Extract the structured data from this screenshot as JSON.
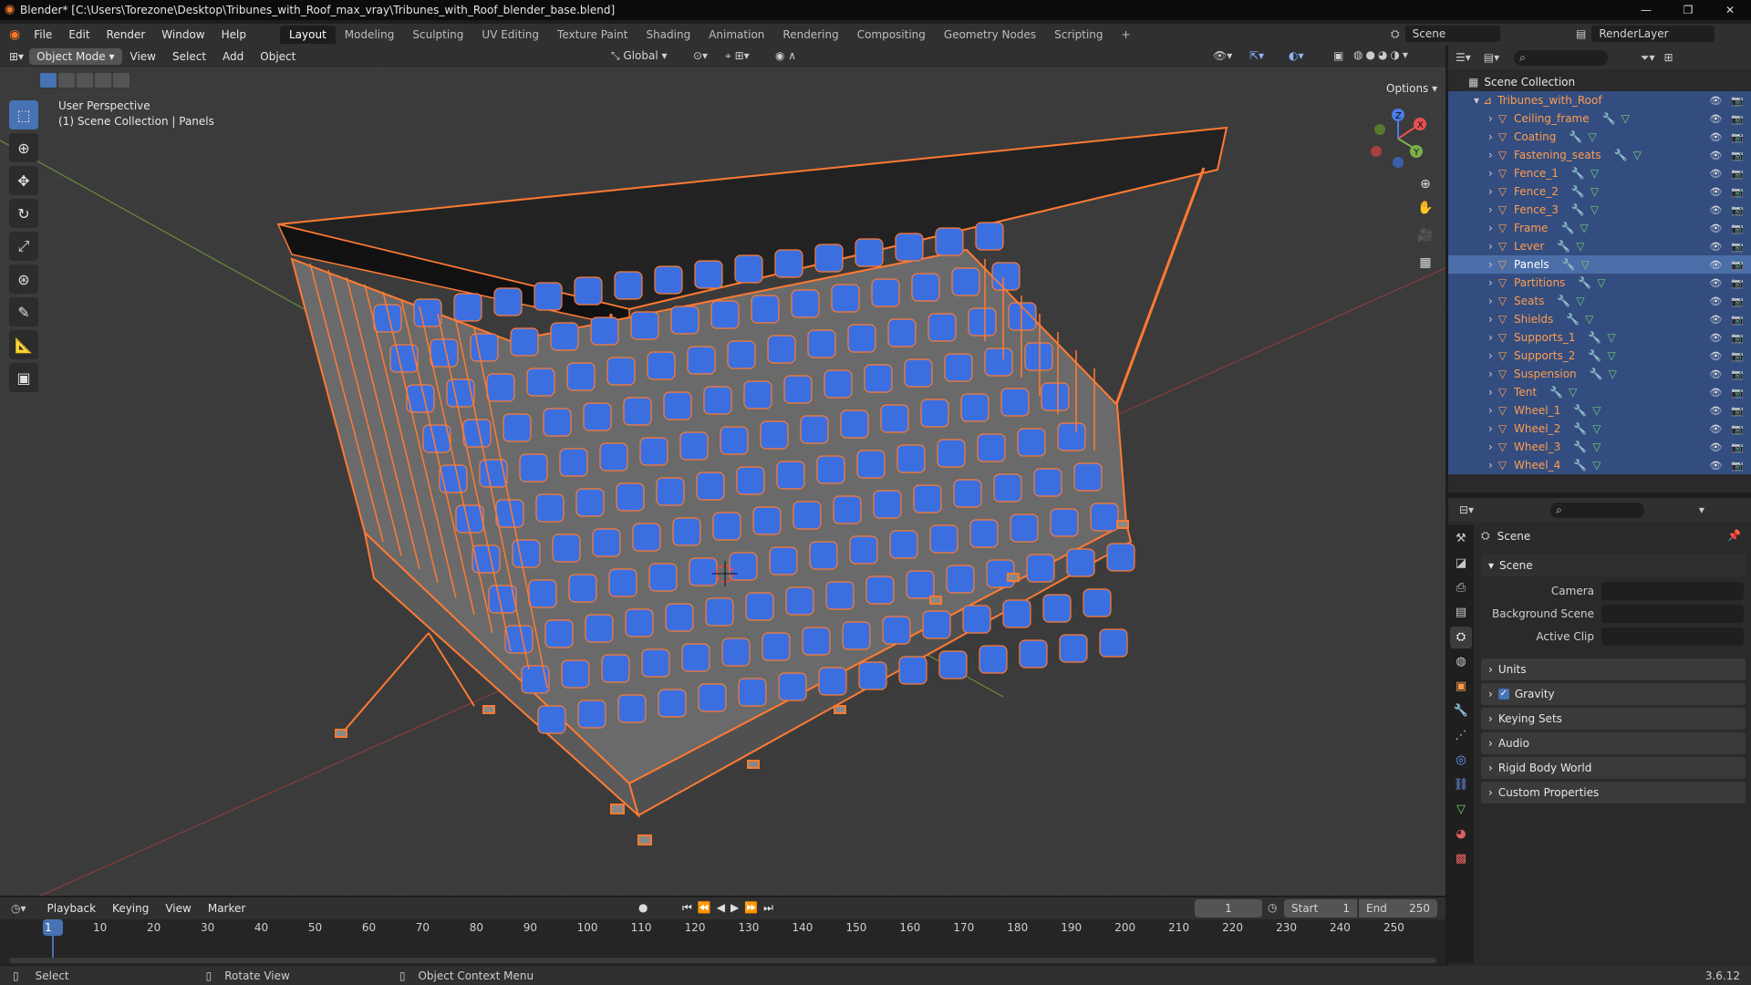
{
  "window": {
    "title": "Blender* [C:\\Users\\Torezone\\Desktop\\Tribunes_with_Roof_max_vray\\Tribunes_with_Roof_blender_base.blend]",
    "controls": [
      "—",
      "❐",
      "✕"
    ]
  },
  "menus": [
    "File",
    "Edit",
    "Render",
    "Window",
    "Help"
  ],
  "workspaces": [
    {
      "label": "Layout",
      "active": true
    },
    {
      "label": "Modeling"
    },
    {
      "label": "Sculpting"
    },
    {
      "label": "UV Editing"
    },
    {
      "label": "Texture Paint"
    },
    {
      "label": "Shading"
    },
    {
      "label": "Animation"
    },
    {
      "label": "Rendering"
    },
    {
      "label": "Compositing"
    },
    {
      "label": "Geometry Nodes"
    },
    {
      "label": "Scripting"
    },
    {
      "label": "+"
    }
  ],
  "scene_selector": "Scene",
  "render_layer": "RenderLayer",
  "viewport_header": {
    "mode": "Object Mode",
    "menus": [
      "View",
      "Select",
      "Add",
      "Object"
    ],
    "orientation": "Global",
    "options": "Options"
  },
  "viewport": {
    "perspective": "User Perspective",
    "collection_info": "(1) Scene Collection | Panels",
    "gizmo_axes": [
      "X",
      "Y",
      "Z"
    ]
  },
  "outliner": {
    "root": "Scene Collection",
    "collection": "Tribunes_with_Roof",
    "objects": [
      "Ceiling_frame",
      "Coating",
      "Fastening_seats",
      "Fence_1",
      "Fence_2",
      "Fence_3",
      "Frame",
      "Lever",
      "Panels",
      "Partitions",
      "Seats",
      "Shields",
      "Supports_1",
      "Supports_2",
      "Suspension",
      "Tent",
      "Wheel_1",
      "Wheel_2",
      "Wheel_3",
      "Wheel_4"
    ],
    "active_object": "Panels"
  },
  "properties": {
    "title": "Scene",
    "section": "Scene",
    "fields": [
      "Camera",
      "Background Scene",
      "Active Clip"
    ],
    "panels": [
      "Units",
      "Gravity",
      "Keying Sets",
      "Audio",
      "Rigid Body World",
      "Custom Properties"
    ],
    "gravity_checked": true
  },
  "timeline": {
    "menus": [
      "Playback",
      "Keying",
      "View",
      "Marker"
    ],
    "current_frame": "1",
    "start_label": "Start",
    "start": "1",
    "end_label": "End",
    "end": "250",
    "ticks": [
      "1",
      "10",
      "20",
      "30",
      "40",
      "50",
      "60",
      "70",
      "80",
      "90",
      "100",
      "110",
      "120",
      "130",
      "140",
      "150",
      "160",
      "170",
      "180",
      "190",
      "200",
      "210",
      "220",
      "230",
      "240",
      "250"
    ]
  },
  "statusbar": {
    "select": "Select",
    "rotate": "Rotate View",
    "context": "Object Context Menu",
    "version": "3.6.12"
  },
  "colors": {
    "selection_orange": "#ff7a33",
    "seat_blue": "#3b6fe0",
    "active_blue": "#4772b3",
    "outliner_select": "#334d80"
  }
}
